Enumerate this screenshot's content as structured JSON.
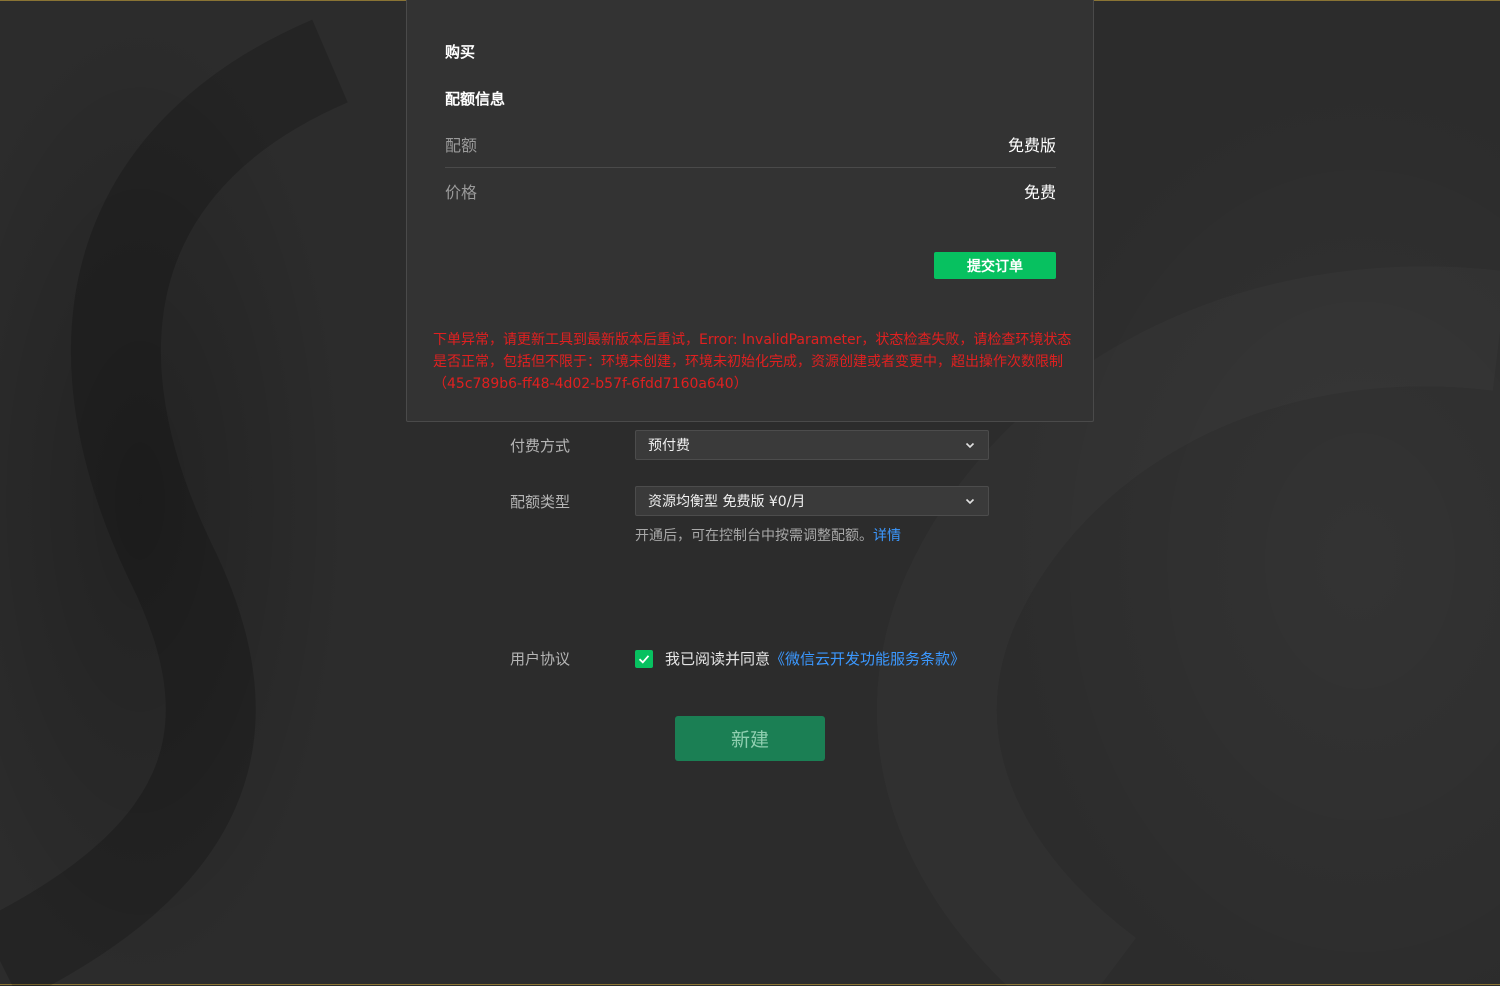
{
  "colors": {
    "background": "#2c2c2c",
    "panel": "#333333",
    "accent_green": "#07c160",
    "link_blue": "#3b98ff",
    "error_red": "#e02020"
  },
  "panel": {
    "title": "购买",
    "subtitle": "配额信息",
    "rows": [
      {
        "label": "配额",
        "value": "免费版"
      },
      {
        "label": "价格",
        "value": "免费"
      }
    ],
    "submit_label": "提交订单",
    "error_message": "下单异常，请更新工具到最新版本后重试，Error: InvalidParameter，状态检查失败，请检查环境状态是否正常，包括但不限于：环境未创建，环境未初始化完成，资源创建或者变更中，超出操作次数限制（45c789b6-ff48-4d02-b57f-6fdd7160a640）"
  },
  "form": {
    "payment": {
      "label": "付费方式",
      "value": "预付费",
      "icon": "chevron-down-icon"
    },
    "quota_type": {
      "label": "配额类型",
      "value": "资源均衡型 免费版 ¥0/月",
      "icon": "chevron-down-icon"
    },
    "hint_text": "开通后，可在控制台中按需调整配额。",
    "hint_link": "详情",
    "agreement": {
      "label": "用户协议",
      "checked": true,
      "text": "我已阅读并同意",
      "link": "《微信云开发功能服务条款》"
    },
    "create_label": "新建"
  }
}
